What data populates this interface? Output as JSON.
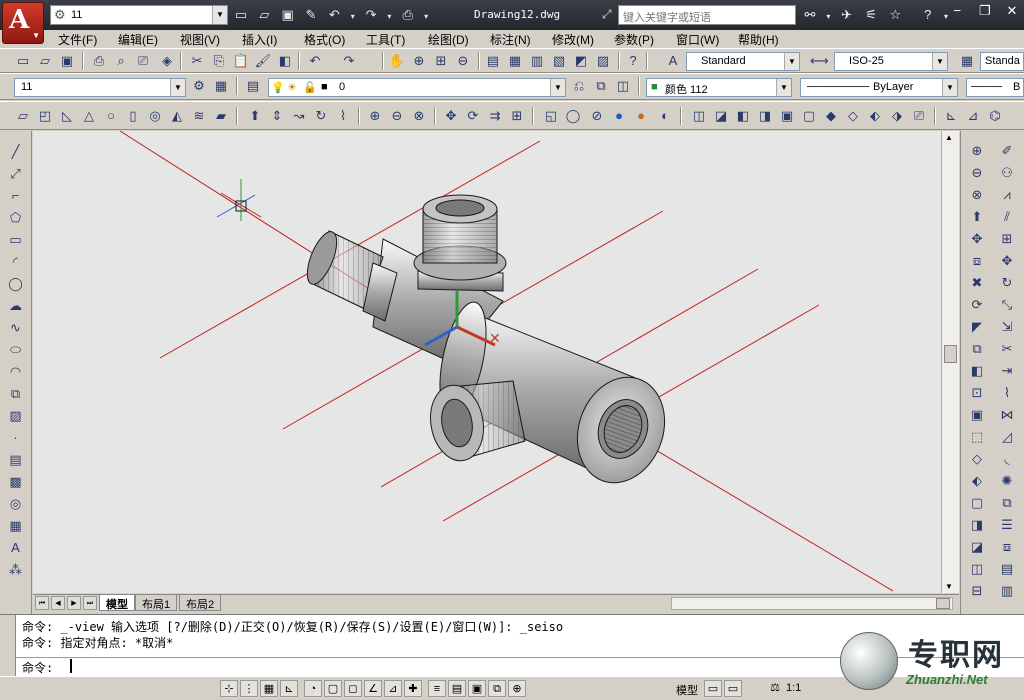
{
  "app": {
    "workspace": "11",
    "title": "Drawing12.dwg",
    "search_placeholder": "键入关键字或短语"
  },
  "menu": [
    "文件(F)",
    "编辑(E)",
    "视图(V)",
    "插入(I)",
    "格式(O)",
    "工具(T)",
    "绘图(D)",
    "标注(N)",
    "修改(M)",
    "参数(P)",
    "窗口(W)",
    "帮助(H)"
  ],
  "styles": {
    "text_style": "Standard",
    "dim_style": "ISO-25",
    "table_style": "Standa"
  },
  "layers": {
    "workspace_combo": "11",
    "current_layer": "0",
    "color": "颜色 112",
    "linetype": "ByLayer",
    "lineweight": "B"
  },
  "layout_tabs": [
    "模型",
    "布局1",
    "布局2"
  ],
  "command": {
    "history": [
      "命令: _-view 输入选项 [?/删除(D)/正交(O)/恢复(R)/保存(S)/设置(E)/窗口(W)]: _seiso",
      "命令: 指定对角点: *取消*"
    ],
    "prompt": "命令:"
  },
  "status": {
    "space": "模型",
    "annotation_scale": "1:1"
  },
  "watermark": {
    "cn": "专职网",
    "en": "Zhuanzhi.Net"
  },
  "colors": {
    "title_bg": "#2b3038",
    "ui_gray": "#d4d0c8",
    "viewport_bg": "#e6e6e6",
    "construction_line": "#c22020",
    "ucs_x": "#c0392b",
    "ucs_y": "#2e9a3a",
    "ucs_z": "#2f5fd0"
  }
}
